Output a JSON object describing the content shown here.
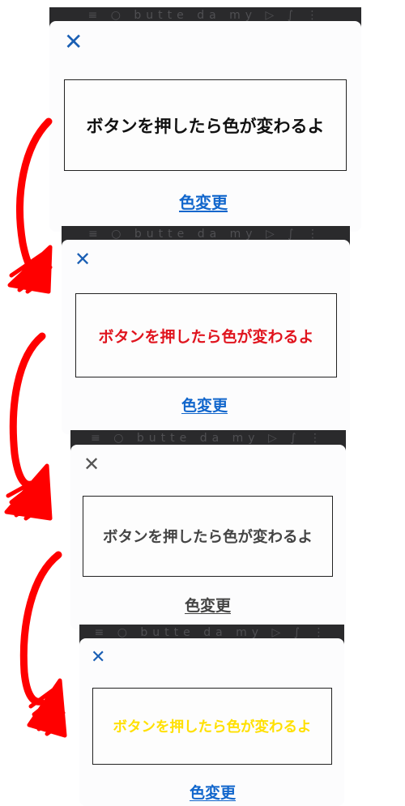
{
  "app": {
    "strip_decoration": "≡  ○   butte da my   ▷  ∫  ⋮",
    "close_glyph": "✕"
  },
  "frames": [
    {
      "message": "ボタンを押したら色が変わるよ",
      "message_color": "#111111",
      "button_label": "色変更",
      "button_color": "#1166cc",
      "close_color": "#1a5fb4"
    },
    {
      "message": "ボタンを押したら色が変わるよ",
      "message_color": "#e0141e",
      "button_label": "色変更",
      "button_color": "#1166cc",
      "close_color": "#1a5fb4"
    },
    {
      "message": "ボタンを押したら色が変わるよ",
      "message_color": "#444444",
      "button_label": "色変更",
      "button_color": "#444444",
      "close_color": "#555555"
    },
    {
      "message": "ボタンを押したら色が変わるよ",
      "message_color": "#ffe000",
      "button_label": "色変更",
      "button_color": "#1166cc",
      "close_color": "#1a5fb4"
    }
  ],
  "annotation": {
    "arrow_color": "#ff0000"
  }
}
